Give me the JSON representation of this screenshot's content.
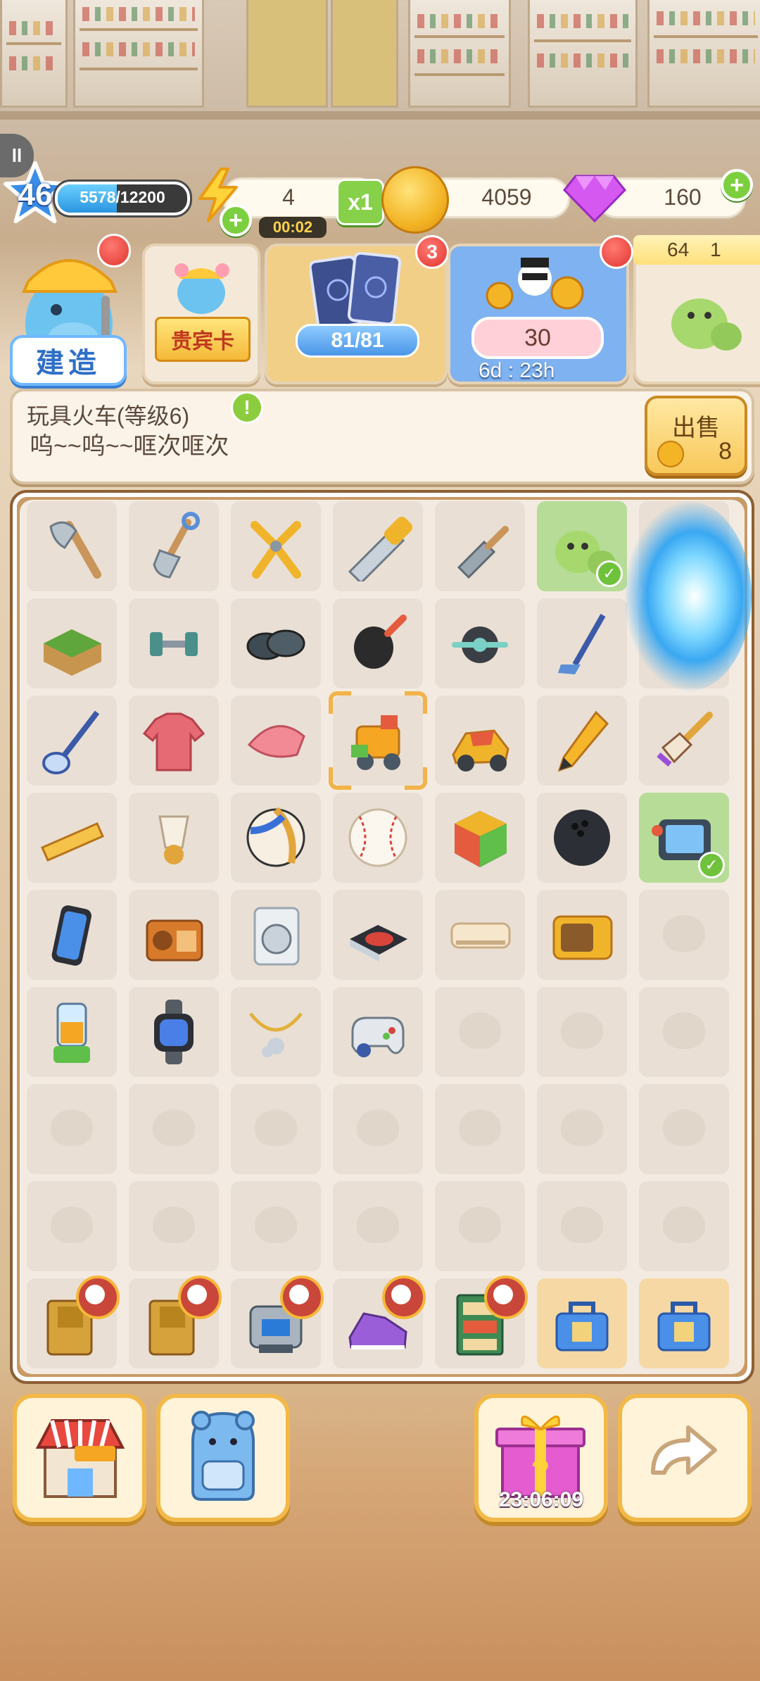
{
  "hud": {
    "level": "46",
    "xp_text": "5578/12200",
    "xp_progress": 0.457,
    "energy": "4",
    "energy_timer": "00:02",
    "multiplier": "x1",
    "coins": "4059",
    "gems": "160"
  },
  "features": {
    "build_label": "建造",
    "vip_label": "贵宾卡",
    "cards_badge": "3",
    "cards_progress": "81/81",
    "event_value": "30",
    "event_time": "6d : 23h",
    "partial_coins": "64",
    "partial_more": "1"
  },
  "info": {
    "title": "玩具火车(等级6)",
    "description": "呜~~呜~~哐次哐次",
    "sell_label": "出售",
    "sell_price": "8"
  },
  "bottom": {
    "gift_timer": "23:06:09"
  },
  "icons": {
    "info": "!",
    "plus": "+",
    "check": "✓"
  },
  "colors": {
    "accent_gold": "#f2b949",
    "accent_green": "#7ccf3e",
    "badge_red": "#e0352f",
    "xp_blue": "#2b95e0"
  }
}
